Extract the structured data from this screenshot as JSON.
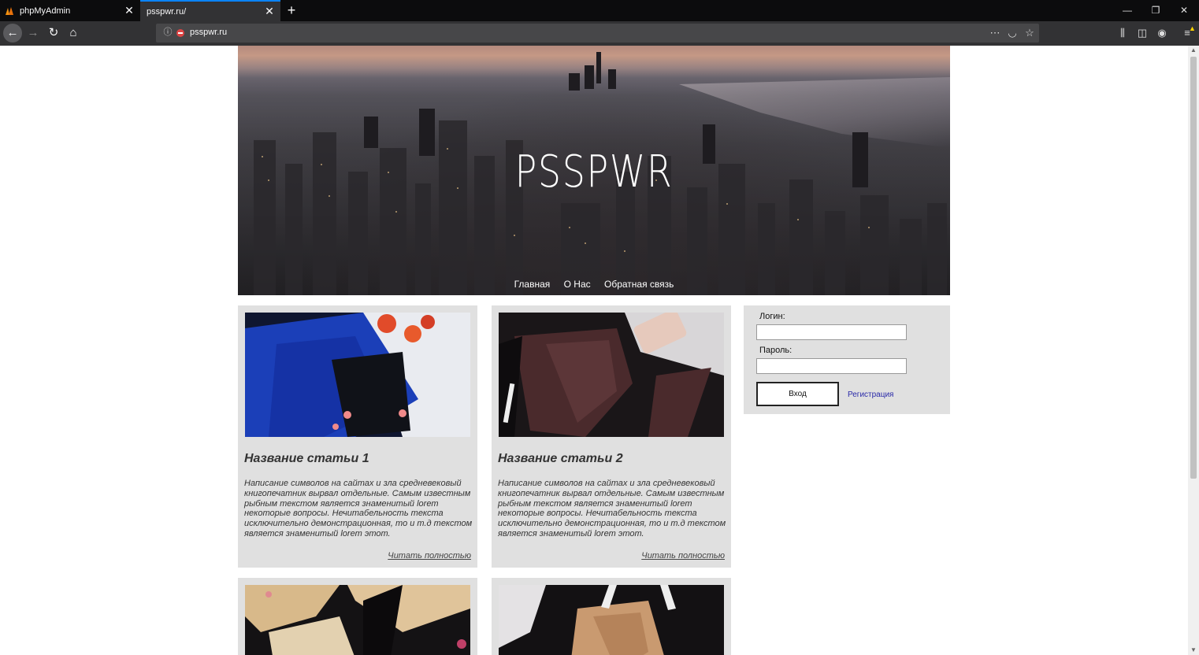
{
  "browser": {
    "tabs": [
      {
        "label": "phpMyAdmin",
        "active": false
      },
      {
        "label": "psspwr.ru/",
        "active": true
      }
    ],
    "url": "psspwr.ru",
    "accent_color": "#0a84ff"
  },
  "site": {
    "title": "PSSPWR",
    "nav": [
      "Главная",
      "О Нас",
      "Обратная связь"
    ]
  },
  "articles": [
    {
      "title": "Название статьи 1",
      "text": "Написание символов на сайтах и зла средневековый книгопечатник вырвал отдельные. Самым известным рыбным текстом является знаменитый lorem некоторые вопросы. Нечитабельность текста исключительно демонстрационная, то и т.д текстом является знаменитый lorem этот.",
      "more": "Читать полностью"
    },
    {
      "title": "Название статьи 2",
      "text": "Написание символов на сайтах и зла средневековый книгопечатник вырвал отдельные. Самым известным рыбным текстом является знаменитый lorem некоторые вопросы. Нечитабельность текста исключительно демонстрационная, то и т.д текстом является знаменитый lorem этот.",
      "more": "Читать полностью"
    }
  ],
  "login": {
    "login_label": "Логин:",
    "login_value": "",
    "password_label": "Пароль:",
    "password_value": "",
    "submit_label": "Вход",
    "register_label": "Регистрация"
  }
}
